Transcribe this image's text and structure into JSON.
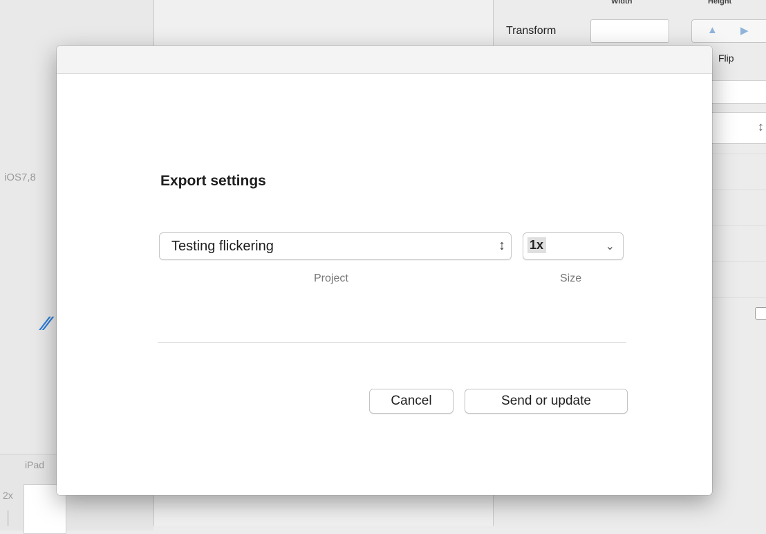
{
  "background": {
    "left_panel": {
      "device_label": "iOS7,8",
      "ipad_label": "iPad",
      "scale_label": "2x"
    },
    "inspector": {
      "column_heading_width": "Width",
      "column_heading_height": "Height",
      "transform_label": "Transform",
      "flip_label": "Flip"
    }
  },
  "dialog": {
    "title": "Export settings",
    "project": {
      "selected": "Testing flickering",
      "caption": "Project"
    },
    "size": {
      "selected": "1x",
      "caption": "Size"
    },
    "buttons": {
      "cancel": "Cancel",
      "confirm": "Send or update"
    }
  },
  "icons": {
    "project_stepper": "updown-chevrons-icon",
    "size_dropdown": "chevron-down-icon",
    "flip_horizontal": "flip-horizontal-icon",
    "flip_vertical": "flip-vertical-icon",
    "brush": "brush-icon"
  },
  "colors": {
    "accent_blue": "#2a7dd8",
    "dialog_background": "#ffffff",
    "window_background": "#ececec"
  }
}
